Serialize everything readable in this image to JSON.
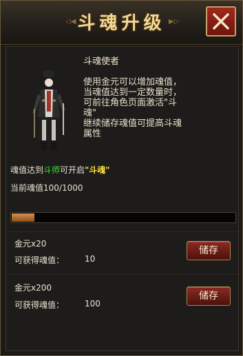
{
  "dialog": {
    "title": "斗魂升级",
    "close_icon": "close-icon",
    "accent_color": "#f2d79a"
  },
  "npc": {
    "name": "斗魂使者",
    "description": "使用金元可以增加魂值，\n当魂值达到一定数量时，\n可前往角色页面激活\"斗\n魂\"\n继续储存魂值可提高斗魂\n属性"
  },
  "requirement": {
    "prefix": "魂值达到",
    "rank": "斗师",
    "middle": "可开启",
    "target": "\"斗魂\""
  },
  "current": {
    "label": "当前魂值100/1000",
    "value": 100,
    "max": 1000
  },
  "options": [
    {
      "title": "金元x20",
      "gain_label": "可获得魂值：",
      "gain_value": "10",
      "button_label": "储存"
    },
    {
      "title": "金元x200",
      "gain_label": "可获得魂值：",
      "gain_value": "100",
      "button_label": "储存"
    }
  ]
}
